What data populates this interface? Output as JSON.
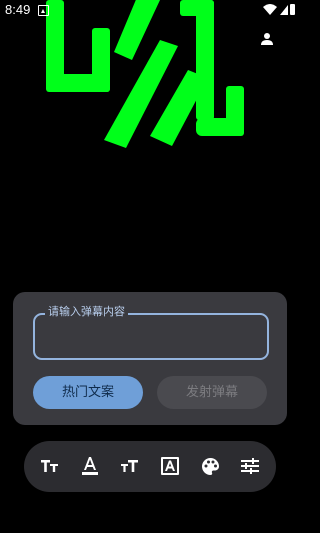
{
  "status_bar": {
    "time": "8:49"
  },
  "input": {
    "label": "请输入弹幕内容",
    "value": ""
  },
  "buttons": {
    "hot_text": "热门文案",
    "send": "发射弹幕"
  },
  "toolbar": {
    "items": [
      "text-size-icon",
      "text-color-icon",
      "font-scale-icon",
      "text-background-icon",
      "palette-icon",
      "settings-sliders-icon"
    ]
  },
  "colors": {
    "logo": "#00ff1a",
    "accent": "#6f9fd8",
    "field_border": "#94b4de",
    "panel": "#3a3a3f",
    "toolbar": "#2c2c30"
  }
}
